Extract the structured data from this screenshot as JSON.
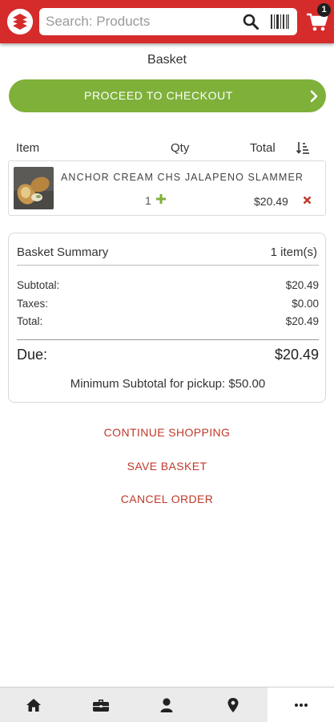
{
  "header": {
    "search_placeholder": "Search: Products",
    "cart_count": "1",
    "colors": {
      "bar": "#d52b2b"
    },
    "icons": [
      "logo-icon",
      "search-icon",
      "barcode-icon",
      "cart-icon"
    ]
  },
  "page": {
    "title": "Basket"
  },
  "checkout": {
    "label": "PROCEED TO CHECKOUT",
    "color": "#7fb03a"
  },
  "table": {
    "headers": {
      "item": "Item",
      "qty": "Qty",
      "total": "Total"
    },
    "items": [
      {
        "name": "ANCHOR CREAM CHS JALAPENO SLAMMER",
        "qty": "1",
        "total": "$20.49"
      }
    ]
  },
  "summary": {
    "title": "Basket Summary",
    "count": "1 item(s)",
    "lines": [
      {
        "label": "Subtotal:",
        "value": "$20.49"
      },
      {
        "label": "Taxes:",
        "value": "$0.00"
      },
      {
        "label": "Total:",
        "value": "$20.49"
      }
    ],
    "due_label": "Due:",
    "due_value": "$20.49",
    "min_note": "Minimum Subtotal for pickup: $50.00"
  },
  "links": {
    "continue": "CONTINUE SHOPPING",
    "save": "SAVE BASKET",
    "cancel": "CANCEL ORDER",
    "color": "#c0392b"
  },
  "nav": {
    "items": [
      "home-icon",
      "briefcase-icon",
      "user-icon",
      "location-pin-icon",
      "more-icon"
    ],
    "active": "more-icon"
  }
}
